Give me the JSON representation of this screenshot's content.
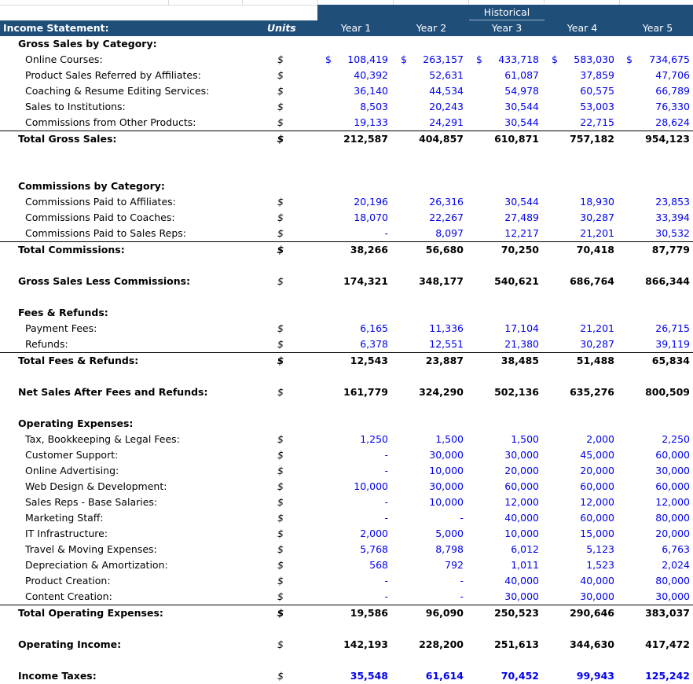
{
  "sheet": {
    "title": "Income Statement:",
    "units_header": "Units",
    "historical_label": "Historical",
    "years": [
      "Year 1",
      "Year 2",
      "Year 3",
      "Year 4",
      "Year 5"
    ]
  },
  "colors": {
    "header_bg": "#1f4e79",
    "input_blue": "#0000ee"
  },
  "rows": [
    {
      "label": "Gross Sales by Category:",
      "level": 0,
      "kind": "section",
      "unit": "",
      "values": []
    },
    {
      "label": "Online Courses:",
      "level": 1,
      "kind": "item",
      "unit": "$",
      "dollars": true,
      "values": [
        "108,419",
        "263,157",
        "433,718",
        "583,030",
        "734,675"
      ]
    },
    {
      "label": "Product Sales Referred by Affiliates:",
      "level": 1,
      "kind": "item",
      "unit": "$",
      "values": [
        "40,392",
        "52,631",
        "61,087",
        "37,859",
        "47,706"
      ]
    },
    {
      "label": "Coaching & Resume Editing Services:",
      "level": 1,
      "kind": "item",
      "unit": "$",
      "values": [
        "36,140",
        "44,534",
        "54,978",
        "60,575",
        "66,789"
      ]
    },
    {
      "label": "Sales to Institutions:",
      "level": 1,
      "kind": "item",
      "unit": "$",
      "values": [
        "8,503",
        "20,243",
        "30,544",
        "53,003",
        "76,330"
      ]
    },
    {
      "label": "Commissions from Other Products:",
      "level": 1,
      "kind": "item",
      "unit": "$",
      "values": [
        "19,133",
        "24,291",
        "30,544",
        "22,715",
        "28,624"
      ]
    },
    {
      "label": "Total Gross Sales:",
      "level": 0,
      "kind": "total",
      "unit": "$",
      "values": [
        "212,587",
        "404,857",
        "610,871",
        "757,182",
        "954,123"
      ]
    },
    {
      "label": "",
      "kind": "blank",
      "values": []
    },
    {
      "label": "",
      "kind": "blank",
      "values": []
    },
    {
      "label": "Commissions by Category:",
      "level": 0,
      "kind": "section",
      "unit": "",
      "values": []
    },
    {
      "label": "Commissions Paid to Affiliates:",
      "level": 1,
      "kind": "item",
      "unit": "$",
      "values": [
        "20,196",
        "26,316",
        "30,544",
        "18,930",
        "23,853"
      ]
    },
    {
      "label": "Commissions Paid to Coaches:",
      "level": 1,
      "kind": "item",
      "unit": "$",
      "values": [
        "18,070",
        "22,267",
        "27,489",
        "30,287",
        "33,394"
      ]
    },
    {
      "label": "Commissions Paid to Sales Reps:",
      "level": 1,
      "kind": "item",
      "unit": "$",
      "values": [
        "-",
        "8,097",
        "12,217",
        "21,201",
        "30,532"
      ]
    },
    {
      "label": "Total Commissions:",
      "level": 0,
      "kind": "total",
      "unit": "$",
      "values": [
        "38,266",
        "56,680",
        "70,250",
        "70,418",
        "87,779"
      ]
    },
    {
      "label": "",
      "kind": "blank",
      "values": []
    },
    {
      "label": "Gross Sales Less Commissions:",
      "level": 0,
      "kind": "calc",
      "unit": "$",
      "values": [
        "174,321",
        "348,177",
        "540,621",
        "686,764",
        "866,344"
      ]
    },
    {
      "label": "",
      "kind": "blank",
      "values": []
    },
    {
      "label": "Fees & Refunds:",
      "level": 0,
      "kind": "section",
      "unit": "",
      "values": []
    },
    {
      "label": "Payment Fees:",
      "level": 1,
      "kind": "item",
      "unit": "$",
      "values": [
        "6,165",
        "11,336",
        "17,104",
        "21,201",
        "26,715"
      ]
    },
    {
      "label": "Refunds:",
      "level": 1,
      "kind": "item",
      "unit": "$",
      "values": [
        "6,378",
        "12,551",
        "21,380",
        "30,287",
        "39,119"
      ]
    },
    {
      "label": "Total Fees & Refunds:",
      "level": 0,
      "kind": "total",
      "unit": "$",
      "values": [
        "12,543",
        "23,887",
        "38,485",
        "51,488",
        "65,834"
      ]
    },
    {
      "label": "",
      "kind": "blank",
      "values": []
    },
    {
      "label": "Net Sales After Fees and Refunds:",
      "level": 0,
      "kind": "calc",
      "unit": "$",
      "values": [
        "161,779",
        "324,290",
        "502,136",
        "635,276",
        "800,509"
      ]
    },
    {
      "label": "",
      "kind": "blank",
      "values": []
    },
    {
      "label": "Operating Expenses:",
      "level": 0,
      "kind": "section",
      "unit": "",
      "values": []
    },
    {
      "label": "Tax, Bookkeeping & Legal Fees:",
      "level": 1,
      "kind": "item",
      "unit": "$",
      "values": [
        "1,250",
        "1,500",
        "1,500",
        "2,000",
        "2,250"
      ]
    },
    {
      "label": "Customer Support:",
      "level": 1,
      "kind": "item",
      "unit": "$",
      "values": [
        "-",
        "30,000",
        "30,000",
        "45,000",
        "60,000"
      ]
    },
    {
      "label": "Online Advertising:",
      "level": 1,
      "kind": "item",
      "unit": "$",
      "values": [
        "-",
        "10,000",
        "20,000",
        "20,000",
        "30,000"
      ]
    },
    {
      "label": "Web Design & Development:",
      "level": 1,
      "kind": "item",
      "unit": "$",
      "values": [
        "10,000",
        "30,000",
        "60,000",
        "60,000",
        "60,000"
      ]
    },
    {
      "label": "Sales Reps - Base Salaries:",
      "level": 1,
      "kind": "item",
      "unit": "$",
      "values": [
        "-",
        "10,000",
        "12,000",
        "12,000",
        "12,000"
      ]
    },
    {
      "label": "Marketing Staff:",
      "level": 1,
      "kind": "item",
      "unit": "$",
      "values": [
        "-",
        "-",
        "40,000",
        "60,000",
        "80,000"
      ]
    },
    {
      "label": "IT Infrastructure:",
      "level": 1,
      "kind": "item",
      "unit": "$",
      "values": [
        "2,000",
        "5,000",
        "10,000",
        "15,000",
        "20,000"
      ]
    },
    {
      "label": "Travel & Moving Expenses:",
      "level": 1,
      "kind": "item",
      "unit": "$",
      "values": [
        "5,768",
        "8,798",
        "6,012",
        "5,123",
        "6,763"
      ]
    },
    {
      "label": "Depreciation & Amortization:",
      "level": 1,
      "kind": "item",
      "unit": "$",
      "values": [
        "568",
        "792",
        "1,011",
        "1,523",
        "2,024"
      ]
    },
    {
      "label": "Product Creation:",
      "level": 1,
      "kind": "item",
      "unit": "$",
      "values": [
        "-",
        "-",
        "40,000",
        "40,000",
        "80,000"
      ]
    },
    {
      "label": "Content Creation:",
      "level": 1,
      "kind": "item",
      "unit": "$",
      "values": [
        "-",
        "-",
        "30,000",
        "30,000",
        "30,000"
      ]
    },
    {
      "label": "Total Operating Expenses:",
      "level": 0,
      "kind": "total",
      "unit": "$",
      "values": [
        "19,586",
        "96,090",
        "250,523",
        "290,646",
        "383,037"
      ]
    },
    {
      "label": "",
      "kind": "blank",
      "values": []
    },
    {
      "label": "Operating Income:",
      "level": 0,
      "kind": "calc",
      "unit": "$",
      "values": [
        "142,193",
        "228,200",
        "251,613",
        "344,630",
        "417,472"
      ]
    },
    {
      "label": "",
      "kind": "blank",
      "values": []
    },
    {
      "label": "Income Taxes:",
      "level": 0,
      "kind": "calc-blue",
      "unit": "$",
      "values": [
        "35,548",
        "61,614",
        "70,452",
        "99,943",
        "125,242"
      ]
    }
  ]
}
